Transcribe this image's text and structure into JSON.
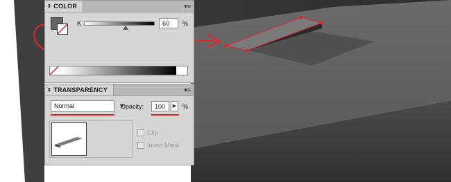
{
  "colors": {
    "accent_red": "#e0262b",
    "panel_bg": "#d6d6d6"
  },
  "color_panel": {
    "tab_label": "COLOR",
    "tab_icon": "collapse-arrows-icon",
    "menu_icon": "panel-menu-icon",
    "channel_label": "K",
    "value": "60",
    "unit": "%",
    "slider_level_percent": 60
  },
  "transparency_panel": {
    "tab_label": "TRANSPARENCY",
    "blend_mode": "Normal",
    "opacity_label": "Opacity:",
    "opacity_value": "100",
    "opacity_unit": "%",
    "clip_label": "Clip",
    "invert_mask_label": "Invert Mask"
  }
}
